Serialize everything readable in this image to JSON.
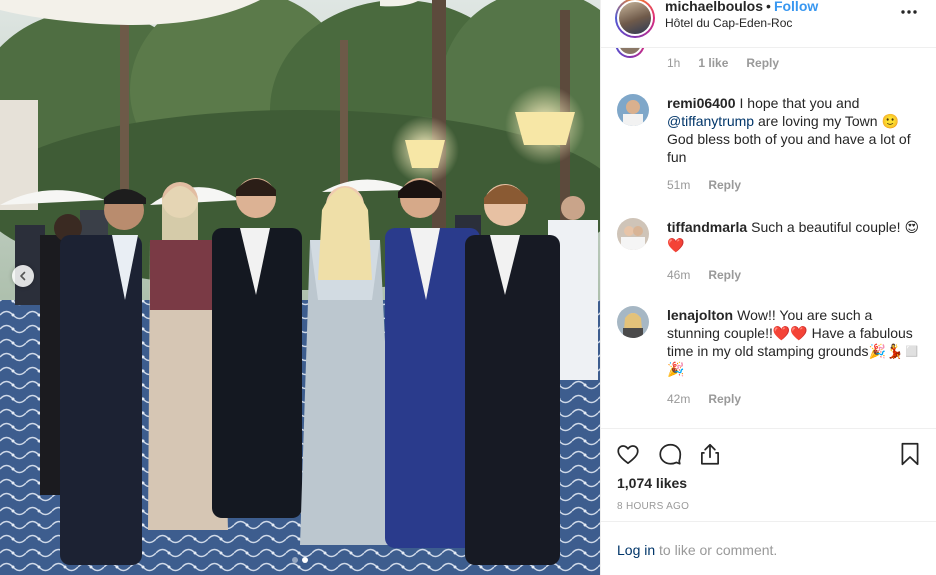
{
  "header": {
    "username": "michaelboulos",
    "separator": "•",
    "follow_label": "Follow",
    "location": "Hôtel du Cap-Eden-Roc",
    "more_icon": "more-horizontal-icon"
  },
  "first_comment_meta": {
    "time": "1h",
    "likes": "1 like",
    "reply": "Reply"
  },
  "comments": [
    {
      "username": "remi06400",
      "text_before": "I hope that you and",
      "mention": "@tiffanytrump",
      "text_after": "are loving my Town 🙂 God bless both of you and have a lot of fun",
      "time": "51m",
      "reply": "Reply"
    },
    {
      "username": "tiffandmarla",
      "text": "Such a beautiful couple! 😍❤️",
      "time": "46m",
      "reply": "Reply"
    },
    {
      "username": "lenajolton",
      "text": "Wow!! You are such a stunning couple!!❤️❤️ Have a fabulous time in my old stamping grounds🎉💃◻️🎉",
      "time": "42m",
      "reply": "Reply"
    }
  ],
  "actions": {
    "like_icon": "heart-icon",
    "comment_icon": "comment-icon",
    "share_icon": "share-icon",
    "save_icon": "bookmark-icon"
  },
  "likes_total": "1,074 likes",
  "timestamp": "8 HOURS AGO",
  "login": {
    "link": "Log in",
    "rest": " to like or comment."
  },
  "carousel": {
    "prev_icon": "chevron-left-icon",
    "slide_count": 2,
    "active_slide": 2
  },
  "colors": {
    "link_blue": "#3897f0",
    "mention_blue": "#003569",
    "muted": "#999999",
    "border": "#efefef"
  }
}
